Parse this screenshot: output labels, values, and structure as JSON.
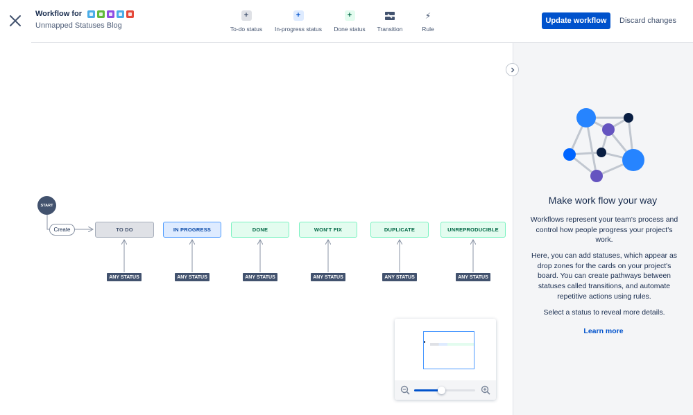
{
  "header": {
    "title": "Workflow for",
    "subtitle": "Unmapped Statuses Blog",
    "issue_type_icons": [
      {
        "name": "subtask-icon",
        "color": "#4bade8"
      },
      {
        "name": "story-icon",
        "color": "#63ba3c"
      },
      {
        "name": "epic-icon",
        "color": "#904ee2"
      },
      {
        "name": "task-icon",
        "color": "#4bade8"
      },
      {
        "name": "bug-icon",
        "color": "#e5493a"
      }
    ]
  },
  "toolbar": {
    "todo_label": "To-do status",
    "inprogress_label": "In-progress status",
    "done_label": "Done status",
    "transition_label": "Transition",
    "rule_label": "Rule",
    "icon_plus": "+",
    "icon_rule": "⚡"
  },
  "actions": {
    "update_label": "Update workflow",
    "discard_label": "Discard changes"
  },
  "colors": {
    "primary": "#0052cc",
    "todo": "#dfe1e6",
    "inprogress": "#deebff",
    "done": "#e3fcef"
  },
  "workflow": {
    "start_label": "START",
    "create_label": "Create",
    "any_status_label": "ANY STATUS",
    "statuses": [
      {
        "label": "TO DO",
        "category": "todo"
      },
      {
        "label": "IN PROGRESS",
        "category": "inprogress"
      },
      {
        "label": "DONE",
        "category": "done"
      },
      {
        "label": "WON'T FIX",
        "category": "done"
      },
      {
        "label": "DUPLICATE",
        "category": "done"
      },
      {
        "label": "UNREPRODUCIBLE",
        "category": "done"
      }
    ]
  },
  "zoom": {
    "level": 0.45
  },
  "panel": {
    "title": "Make work flow your way",
    "paragraph1": "Workflows represent your team's process and control how people progress your project's work.",
    "paragraph2": "Here, you can add statuses, which appear as drop zones for the cards on your project's board. You can create pathways between statuses called transitions, and automate repetitive actions using rules.",
    "paragraph3": "Select a status to reveal more details.",
    "learn_more": "Learn more"
  }
}
